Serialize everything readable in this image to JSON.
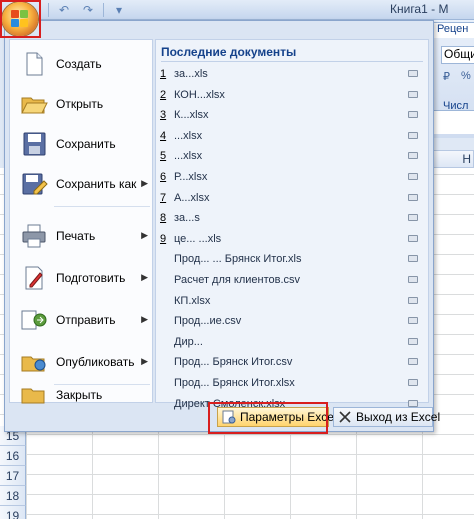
{
  "window": {
    "title": "Книга1 - M"
  },
  "quick_access": {
    "undo_icon": "undo-icon",
    "redo_icon": "redo-icon",
    "customize_icon": "dropdown-icon"
  },
  "ribbon": {
    "tab_label": "Рецен",
    "number_format": "Общий",
    "group_label": "Числ",
    "column_header": "H"
  },
  "menu": {
    "commands": [
      {
        "label": "Создать",
        "icon": "new-document-icon",
        "submenu": false
      },
      {
        "label": "Открыть",
        "icon": "open-folder-icon",
        "submenu": false
      },
      {
        "label": "Сохранить",
        "icon": "save-icon",
        "submenu": false
      },
      {
        "label": "Сохранить как",
        "icon": "save-as-icon",
        "submenu": true
      },
      {
        "label": "Печать",
        "icon": "printer-icon",
        "submenu": true
      },
      {
        "label": "Подготовить",
        "icon": "prepare-icon",
        "submenu": true
      },
      {
        "label": "Отправить",
        "icon": "send-icon",
        "submenu": true
      },
      {
        "label": "Опубликовать",
        "icon": "publish-icon",
        "submenu": true
      },
      {
        "label": "Закрыть",
        "icon": "close-folder-icon",
        "submenu": false
      }
    ],
    "recent_header": "Последние документы",
    "recent_docs": [
      {
        "num": "1",
        "name": "за...xls"
      },
      {
        "num": "2",
        "name": "КОН...xlsx"
      },
      {
        "num": "3",
        "name": "К...xlsx"
      },
      {
        "num": "4",
        "name": "...xlsx"
      },
      {
        "num": "5",
        "name": "...xlsx"
      },
      {
        "num": "6",
        "name": "Р...xlsx"
      },
      {
        "num": "7",
        "name": "А...xlsx"
      },
      {
        "num": "8",
        "name": "за...s"
      },
      {
        "num": "9",
        "name": "це... ...xls"
      },
      {
        "num": "",
        "name": "Прод... ... Брянск Итог.xls"
      },
      {
        "num": "",
        "name": "Расчет для клиентов.csv"
      },
      {
        "num": "",
        "name": "КП.xlsx"
      },
      {
        "num": "",
        "name": "Прод...ие.csv"
      },
      {
        "num": "",
        "name": "Дир..."
      },
      {
        "num": "",
        "name": "Прод... Брянск Итог.csv"
      },
      {
        "num": "",
        "name": "Прод... Брянск Итог.xlsx"
      },
      {
        "num": "",
        "name": "Директ Смоленск.xlsx"
      }
    ],
    "options_button": "Параметры Excel",
    "exit_button": "Выход из Excel"
  },
  "sheet": {
    "rows": [
      "15",
      "16",
      "17",
      "18",
      "19"
    ]
  },
  "colors": {
    "highlight": "#d81e1e",
    "menu_bg": "#dbe5f3",
    "accent_text": "#15428b"
  }
}
